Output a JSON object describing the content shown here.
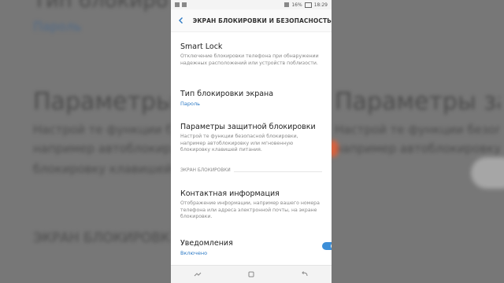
{
  "status_bar": {
    "battery": "16%",
    "time": "18:29"
  },
  "app_bar": {
    "title": "ЭКРАН БЛОКИРОВКИ И БЕЗОПАСНОСТЬ"
  },
  "items": {
    "smart_lock": {
      "title": "Smart Lock",
      "subtitle": "Отключение блокировки телефона при обнаружении надежных расположений или устройств поблизости."
    },
    "lock_type": {
      "title": "Тип блокировки экрана",
      "value": "Пароль"
    },
    "secure_params": {
      "title": "Параметры защитной блокировки",
      "subtitle": "Настрой те функции безопасной блокировки, например автоблокировку или мгновенную блокировку клавишей питания."
    },
    "section_lock_screen": "ЭКРАН БЛОКИРОВКИ",
    "contact_info": {
      "title": "Контактная информация",
      "subtitle": "Отображение информации, например вашего номера телефона или адреса электронной почты, на экране блокировки."
    },
    "notifications": {
      "title": "Уведомления",
      "value": "Включено",
      "enabled": true
    }
  },
  "background": {
    "top": "Тип блокировки",
    "link": "Пароль",
    "heading": "Параметры защитной блокировки",
    "line1": "Настрой те функции безопасной",
    "line2": "например автоблокировку или",
    "line3": "блокировку клавишей питания",
    "section": "ЭКРАН БЛОКИРОВКИ"
  },
  "colors": {
    "accent": "#3d8fd8",
    "link": "#2c79c4"
  }
}
